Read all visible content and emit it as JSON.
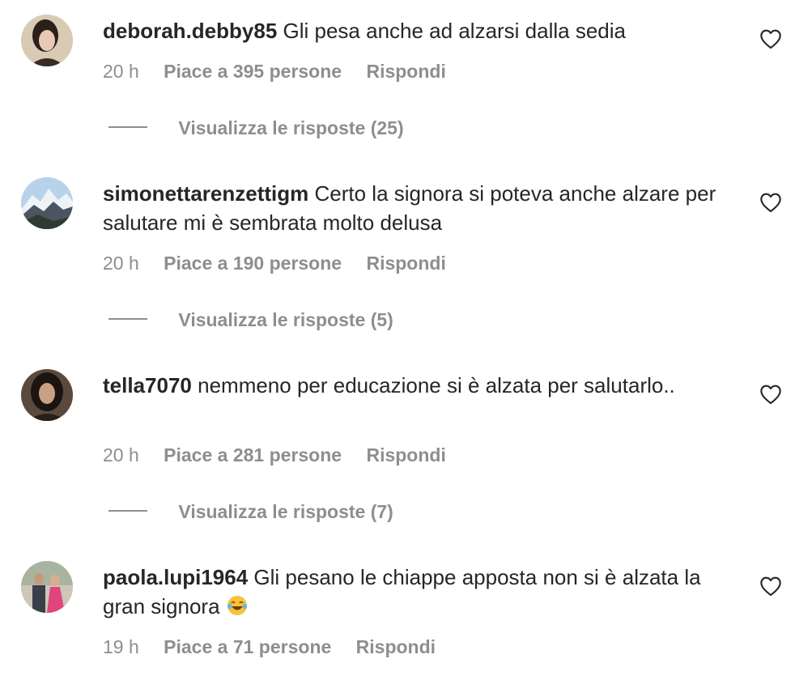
{
  "comments": [
    {
      "username": "deborah.debby85",
      "text": "Gli pesa anche ad alzarsi dalla sedia",
      "time": "20 h",
      "likes": "Piace a 395 persone",
      "reply": "Rispondi",
      "replies": "Visualizza le risposte (25)"
    },
    {
      "username": "simonettarenzettigm",
      "text": "Certo la signora si poteva anche alzare per salutare mi è sembrata molto delusa",
      "time": "20 h",
      "likes": "Piace a 190 persone",
      "reply": "Rispondi",
      "replies": "Visualizza le risposte (5)"
    },
    {
      "username": "tella7070",
      "text": "nemmeno per educazione si è alzata per salutarlo..",
      "time": "20 h",
      "likes": "Piace a 281 persone",
      "reply": "Rispondi",
      "replies": "Visualizza le risposte (7)"
    },
    {
      "username": "paola.lupi1964",
      "text": "Gli pesano le chiappe apposta non si è alzata la gran signora",
      "emoji": "😂",
      "time": "19 h",
      "likes": "Piace a 71 persone",
      "reply": "Rispondi"
    }
  ],
  "colors": {
    "text": "#262626",
    "secondary": "#8e8e8e",
    "background": "#ffffff"
  },
  "icons": [
    "heart-outline-icon",
    "tears-of-joy-emoji"
  ]
}
